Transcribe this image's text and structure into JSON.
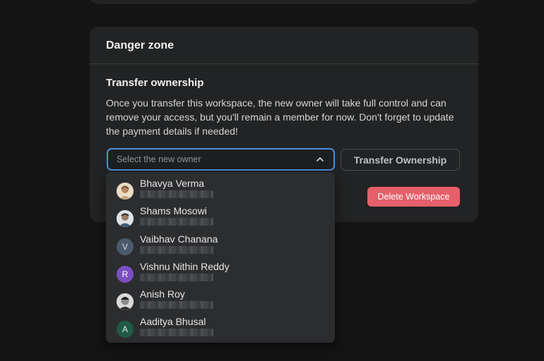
{
  "danger_zone": {
    "title": "Danger zone",
    "transfer": {
      "title": "Transfer ownership",
      "description": "Once you transfer this workspace, the new owner will take full control and can remove your access, but you'll remain a member for now. Don't forget to update the payment details if needed!",
      "select_placeholder": "Select the new owner",
      "button_label": "Transfer Ownership"
    },
    "delete_button_label": "Delete Workspace"
  },
  "owner_options": [
    {
      "name": "Bhavya Verma",
      "avatar": "photo"
    },
    {
      "name": "Shams Mosowi",
      "avatar": "photo"
    },
    {
      "name": "Vaibhav Chanana",
      "avatar": "V"
    },
    {
      "name": "Vishnu Nithin Reddy",
      "avatar": "R"
    },
    {
      "name": "Anish Roy",
      "avatar": "photo"
    },
    {
      "name": "Aaditya Bhusal",
      "avatar": "A"
    }
  ],
  "colors": {
    "accent_focus": "#4c8fe0",
    "danger": "#e5606a",
    "card_bg": "#222324",
    "page_bg": "#141414"
  },
  "icons": {
    "select_chevron": "chevron-up-icon"
  }
}
